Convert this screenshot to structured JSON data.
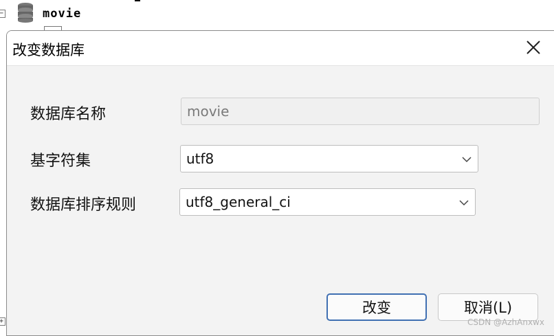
{
  "tree": {
    "expander_symbol": "−",
    "db_label": "movie",
    "db_icon": "database-icon",
    "table_icon": "table-icon"
  },
  "dialog": {
    "title": "改变数据库",
    "close_icon": "close-icon",
    "fields": {
      "db_name_label": "数据库名称",
      "db_name_value": "movie",
      "charset_label": "基字符集",
      "charset_value": "utf8",
      "collation_label": "数据库排序规则",
      "collation_value": "utf8_general_ci"
    },
    "buttons": {
      "ok": "改变",
      "cancel": "取消(L)"
    }
  },
  "watermark": "CSDN @AzhAnxwx",
  "colors": {
    "primary_button_border": "#3f6fb2",
    "content_background": "#f3f3f3"
  }
}
